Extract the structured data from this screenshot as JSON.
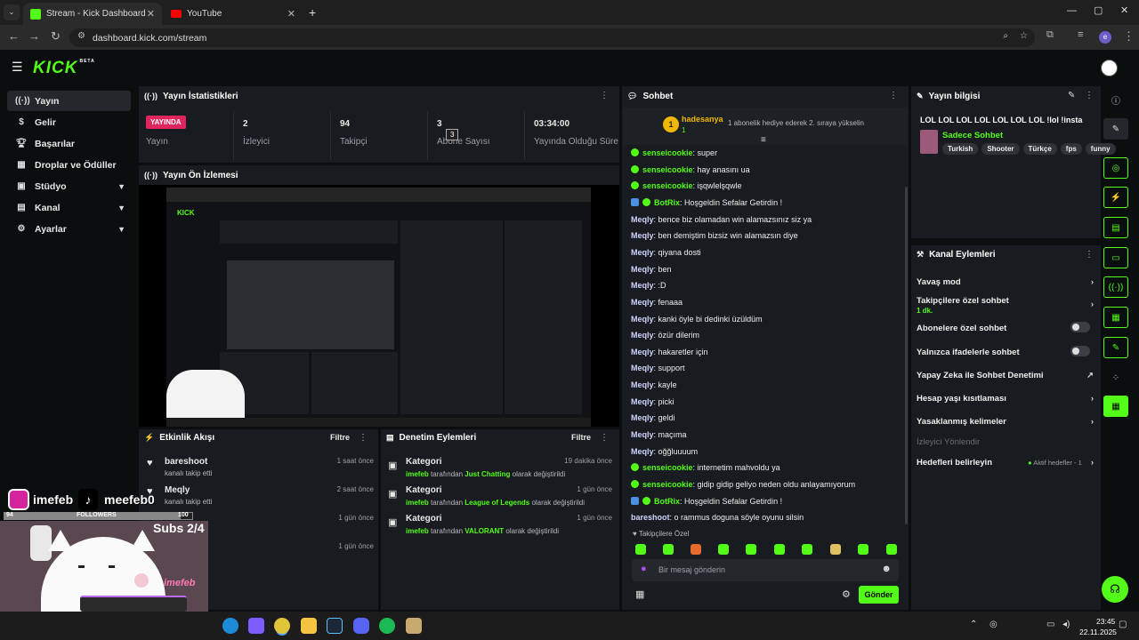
{
  "browser": {
    "tabs": [
      {
        "label": "Stream - Kick Dashboard"
      },
      {
        "label": "YouTube"
      }
    ],
    "url": "dashboard.kick.com/stream"
  },
  "app": {
    "logo": "KICK",
    "logo_sup": "BETA"
  },
  "sidebar": {
    "items": [
      {
        "label": "Yayın"
      },
      {
        "label": "Gelir"
      },
      {
        "label": "Başarılar"
      },
      {
        "label": "Droplar ve Ödüller"
      },
      {
        "label": "Stüdyo"
      },
      {
        "label": "Kanal"
      },
      {
        "label": "Ayarlar"
      }
    ]
  },
  "stats": {
    "title": "Yayın İstatistikleri",
    "live_badge": "YAYINDA",
    "live_label": "Yayın",
    "viewers_value": "2",
    "viewers_label": "İzleyici",
    "followers_value": "94",
    "followers_label": "Takipçi",
    "subs_value": "3",
    "subs_label": "Abone Sayısı",
    "subs_tooltip": "3",
    "uptime_value": "03:34:00",
    "uptime_label": "Yayında Olduğu Süre"
  },
  "preview": {
    "title": "Yayın Ön İzlemesi"
  },
  "activity": {
    "title": "Etkinlik Akışı",
    "filter": "Filtre",
    "items": [
      {
        "name": "bareshoot",
        "desc": "kanalı takip etti",
        "time": "1 saat önce"
      },
      {
        "name": "Meqly",
        "desc": "kanalı takip etti",
        "time": "2 saat önce"
      },
      {
        "name": "",
        "desc": "",
        "time": "1 gün önce"
      },
      {
        "name": "",
        "desc": "",
        "time": "1 gün önce"
      }
    ]
  },
  "modlog": {
    "title": "Denetim Eylemleri",
    "filter": "Filtre",
    "items": [
      {
        "title": "Kategori",
        "user": "imefeb",
        "by": "tarafından",
        "cat": "Just Chatting",
        "suffix": "olarak değiştirildi",
        "time": "19 dakika önce"
      },
      {
        "title": "Kategori",
        "user": "imefeb",
        "by": "tarafından",
        "cat": "League of Legends",
        "suffix": "olarak değiştirildi",
        "time": "1 gün önce"
      },
      {
        "title": "Kategori",
        "user": "imefeb",
        "by": "tarafından",
        "cat": "VALORANT",
        "suffix": "olarak değiştirildi",
        "time": "1 gün önce"
      }
    ]
  },
  "chat": {
    "title": "Sohbet",
    "pinned_user": "hadesanya",
    "pinned_count": "1",
    "pinned_text": "1 abonelik hediye ederek 2. sıraya yükselin",
    "messages": [
      {
        "user": "senseicookie",
        "text": "super"
      },
      {
        "user": "senseicookie",
        "text": "hay anasını ua"
      },
      {
        "user": "senseicookie",
        "text": "işqwlelşqwle"
      },
      {
        "user": "BotRix",
        "text": "Hoşgeldin Sefalar Getirdin !"
      },
      {
        "user": "Meqly",
        "text": "bence biz olamadan win alamazsınız siz ya"
      },
      {
        "user": "Meqly",
        "text": "ben demiştim bizsiz win alamazsın diye"
      },
      {
        "user": "Meqly",
        "text": "qiyana dosti"
      },
      {
        "user": "Meqly",
        "text": "ben"
      },
      {
        "user": "Meqly",
        "text": ":D"
      },
      {
        "user": "Meqly",
        "text": "fenaaa"
      },
      {
        "user": "Meqly",
        "text": "kanki öyle bi dedinki üzüldüm"
      },
      {
        "user": "Meqly",
        "text": "özür dilerim"
      },
      {
        "user": "Meqly",
        "text": "hakaretler için"
      },
      {
        "user": "Meqly",
        "text": "support"
      },
      {
        "user": "Meqly",
        "text": "kayle"
      },
      {
        "user": "Meqly",
        "text": "picki"
      },
      {
        "user": "Meqly",
        "text": "geldi"
      },
      {
        "user": "Meqly",
        "text": "maçıma"
      },
      {
        "user": "Meqly",
        "text": "oğğluuuum"
      },
      {
        "user": "senseicookie",
        "text": "internetim mahvoldu ya"
      },
      {
        "user": "senseicookie",
        "text": "gidip gidip geliyo neden oldu anlayamıyorum"
      },
      {
        "user": "BotRix",
        "text": "Hoşgeldin Sefalar Getirdin !"
      },
      {
        "user": "bareshoot",
        "text": "o rammus doguna söyle oyunu silsin"
      }
    ],
    "followers_only": "Takipçilere Özel",
    "input_placeholder": "Bir mesaj gönderin",
    "send_label": "Gönder"
  },
  "stream_info": {
    "title": "Yayın bilgisi",
    "stream_title": "LOL LOL LOL LOL LOL LOL LOL !lol !insta",
    "category": "Sadece Sohbet",
    "tags": [
      "Turkish",
      "Shooter",
      "Türkçe",
      "fps",
      "funny"
    ]
  },
  "channel_actions": {
    "title": "Kanal Eylemleri",
    "items": [
      {
        "label": "Yavaş mod"
      },
      {
        "label": "Takipçilere özel sohbet",
        "sub": "1 dk."
      },
      {
        "label": "Abonelere özel sohbet"
      },
      {
        "label": "Yalnızca ifadelerle sohbet"
      },
      {
        "label": "Yapay Zeka ile Sohbet Denetimi"
      },
      {
        "label": "Hesap yaşı kısıtlaması"
      },
      {
        "label": "Yasaklanmış kelimeler"
      },
      {
        "label": "İzleyici Yönlendir"
      },
      {
        "label": "Hedefleri belirleyin",
        "status": "Aktif hedefler - 1"
      }
    ]
  },
  "overlay": {
    "instagram": "imefeb",
    "tiktok": "meefeb0",
    "followers_value": "94",
    "followers_label": "FOLLOWERS",
    "followers_goal": "100",
    "subs": "Subs 2/4",
    "signature": "imefeb"
  },
  "taskbar": {
    "time": "23:45",
    "date": "22.11.2025"
  },
  "colors": {
    "accent": "#53fc18",
    "live": "#e0245e",
    "panel": "#181b1f",
    "bg": "#0b0e0f"
  }
}
